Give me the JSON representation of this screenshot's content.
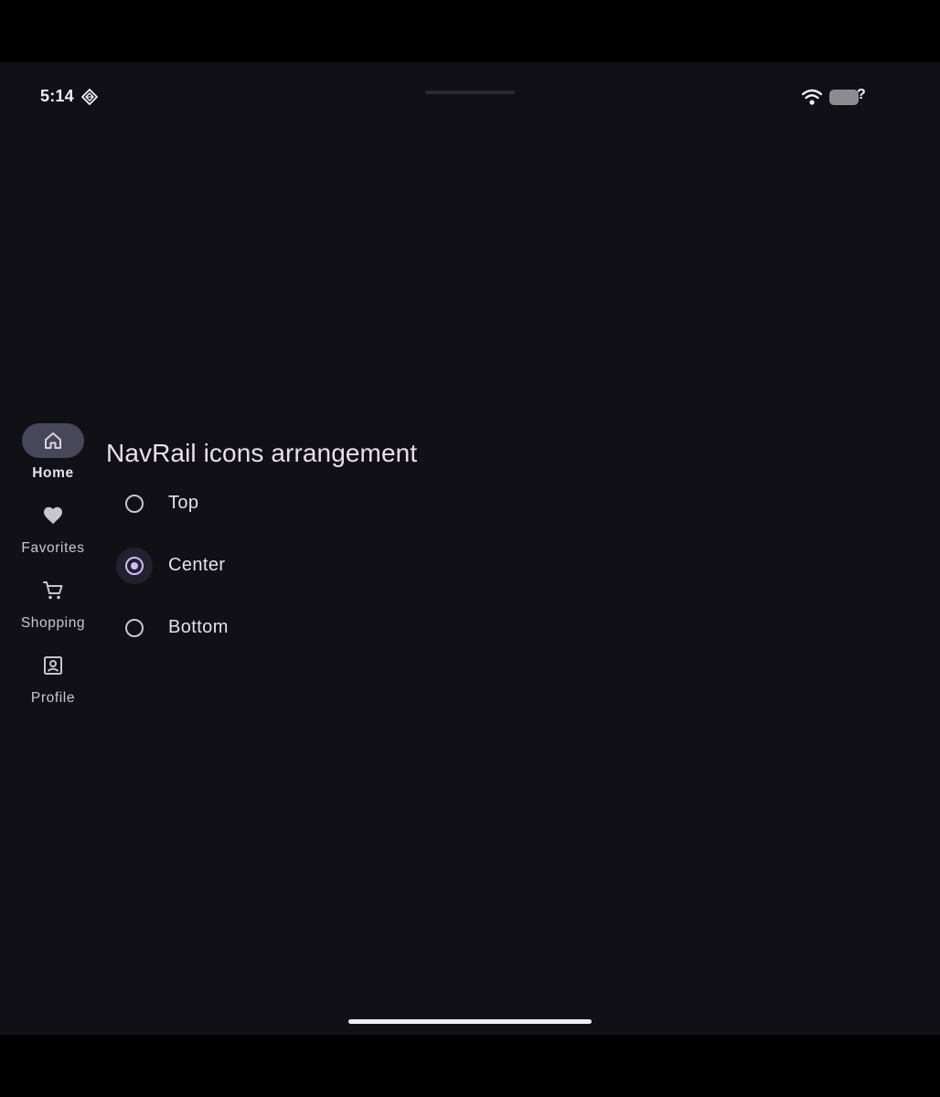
{
  "status_bar": {
    "time": "5:14",
    "battery_suffix": "?",
    "icons": [
      "diamond-notification-icon",
      "wifi-icon",
      "battery-icon"
    ]
  },
  "nav_rail": {
    "items": [
      {
        "label": "Home",
        "icon": "home-icon",
        "active": true
      },
      {
        "label": "Favorites",
        "icon": "heart-icon",
        "active": false
      },
      {
        "label": "Shopping",
        "icon": "shopping-cart-icon",
        "active": false
      },
      {
        "label": "Profile",
        "icon": "profile-icon",
        "active": false
      }
    ]
  },
  "main": {
    "title": "NavRail icons arrangement",
    "options": [
      {
        "label": "Top",
        "selected": false
      },
      {
        "label": "Center",
        "selected": true
      },
      {
        "label": "Bottom",
        "selected": false
      }
    ]
  },
  "colors": {
    "background": "#111017",
    "accent": "#cdbdfc",
    "nav_active_indicator": "#484659",
    "text_primary": "#e6e1ea",
    "text_secondary": "#cac6d2"
  }
}
